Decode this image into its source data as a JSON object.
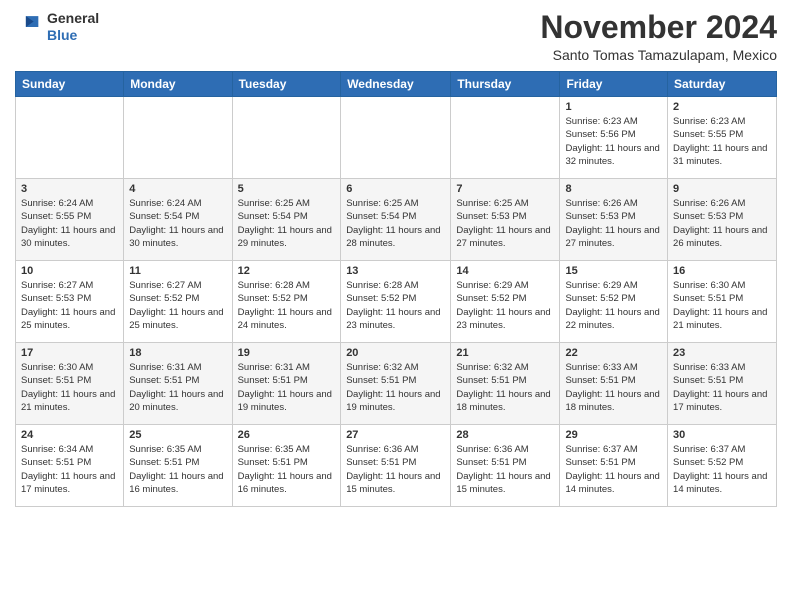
{
  "header": {
    "logo": {
      "general": "General",
      "blue": "Blue"
    },
    "month": "November 2024",
    "location": "Santo Tomas Tamazulapam, Mexico"
  },
  "weekdays": [
    "Sunday",
    "Monday",
    "Tuesday",
    "Wednesday",
    "Thursday",
    "Friday",
    "Saturday"
  ],
  "weeks": [
    [
      {
        "day": "",
        "info": ""
      },
      {
        "day": "",
        "info": ""
      },
      {
        "day": "",
        "info": ""
      },
      {
        "day": "",
        "info": ""
      },
      {
        "day": "",
        "info": ""
      },
      {
        "day": "1",
        "info": "Sunrise: 6:23 AM\nSunset: 5:56 PM\nDaylight: 11 hours and 32 minutes."
      },
      {
        "day": "2",
        "info": "Sunrise: 6:23 AM\nSunset: 5:55 PM\nDaylight: 11 hours and 31 minutes."
      }
    ],
    [
      {
        "day": "3",
        "info": "Sunrise: 6:24 AM\nSunset: 5:55 PM\nDaylight: 11 hours and 30 minutes."
      },
      {
        "day": "4",
        "info": "Sunrise: 6:24 AM\nSunset: 5:54 PM\nDaylight: 11 hours and 30 minutes."
      },
      {
        "day": "5",
        "info": "Sunrise: 6:25 AM\nSunset: 5:54 PM\nDaylight: 11 hours and 29 minutes."
      },
      {
        "day": "6",
        "info": "Sunrise: 6:25 AM\nSunset: 5:54 PM\nDaylight: 11 hours and 28 minutes."
      },
      {
        "day": "7",
        "info": "Sunrise: 6:25 AM\nSunset: 5:53 PM\nDaylight: 11 hours and 27 minutes."
      },
      {
        "day": "8",
        "info": "Sunrise: 6:26 AM\nSunset: 5:53 PM\nDaylight: 11 hours and 27 minutes."
      },
      {
        "day": "9",
        "info": "Sunrise: 6:26 AM\nSunset: 5:53 PM\nDaylight: 11 hours and 26 minutes."
      }
    ],
    [
      {
        "day": "10",
        "info": "Sunrise: 6:27 AM\nSunset: 5:53 PM\nDaylight: 11 hours and 25 minutes."
      },
      {
        "day": "11",
        "info": "Sunrise: 6:27 AM\nSunset: 5:52 PM\nDaylight: 11 hours and 25 minutes."
      },
      {
        "day": "12",
        "info": "Sunrise: 6:28 AM\nSunset: 5:52 PM\nDaylight: 11 hours and 24 minutes."
      },
      {
        "day": "13",
        "info": "Sunrise: 6:28 AM\nSunset: 5:52 PM\nDaylight: 11 hours and 23 minutes."
      },
      {
        "day": "14",
        "info": "Sunrise: 6:29 AM\nSunset: 5:52 PM\nDaylight: 11 hours and 23 minutes."
      },
      {
        "day": "15",
        "info": "Sunrise: 6:29 AM\nSunset: 5:52 PM\nDaylight: 11 hours and 22 minutes."
      },
      {
        "day": "16",
        "info": "Sunrise: 6:30 AM\nSunset: 5:51 PM\nDaylight: 11 hours and 21 minutes."
      }
    ],
    [
      {
        "day": "17",
        "info": "Sunrise: 6:30 AM\nSunset: 5:51 PM\nDaylight: 11 hours and 21 minutes."
      },
      {
        "day": "18",
        "info": "Sunrise: 6:31 AM\nSunset: 5:51 PM\nDaylight: 11 hours and 20 minutes."
      },
      {
        "day": "19",
        "info": "Sunrise: 6:31 AM\nSunset: 5:51 PM\nDaylight: 11 hours and 19 minutes."
      },
      {
        "day": "20",
        "info": "Sunrise: 6:32 AM\nSunset: 5:51 PM\nDaylight: 11 hours and 19 minutes."
      },
      {
        "day": "21",
        "info": "Sunrise: 6:32 AM\nSunset: 5:51 PM\nDaylight: 11 hours and 18 minutes."
      },
      {
        "day": "22",
        "info": "Sunrise: 6:33 AM\nSunset: 5:51 PM\nDaylight: 11 hours and 18 minutes."
      },
      {
        "day": "23",
        "info": "Sunrise: 6:33 AM\nSunset: 5:51 PM\nDaylight: 11 hours and 17 minutes."
      }
    ],
    [
      {
        "day": "24",
        "info": "Sunrise: 6:34 AM\nSunset: 5:51 PM\nDaylight: 11 hours and 17 minutes."
      },
      {
        "day": "25",
        "info": "Sunrise: 6:35 AM\nSunset: 5:51 PM\nDaylight: 11 hours and 16 minutes."
      },
      {
        "day": "26",
        "info": "Sunrise: 6:35 AM\nSunset: 5:51 PM\nDaylight: 11 hours and 16 minutes."
      },
      {
        "day": "27",
        "info": "Sunrise: 6:36 AM\nSunset: 5:51 PM\nDaylight: 11 hours and 15 minutes."
      },
      {
        "day": "28",
        "info": "Sunrise: 6:36 AM\nSunset: 5:51 PM\nDaylight: 11 hours and 15 minutes."
      },
      {
        "day": "29",
        "info": "Sunrise: 6:37 AM\nSunset: 5:51 PM\nDaylight: 11 hours and 14 minutes."
      },
      {
        "day": "30",
        "info": "Sunrise: 6:37 AM\nSunset: 5:52 PM\nDaylight: 11 hours and 14 minutes."
      }
    ]
  ]
}
